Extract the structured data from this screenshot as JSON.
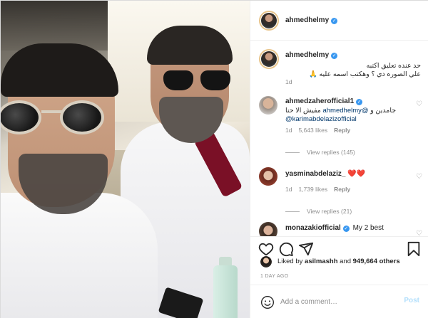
{
  "post": {
    "author": "ahmedhelmy",
    "caption_line1": "حد عنده تعليق اكتبه",
    "caption_line2": "علي الصوره دي ؟ وهكتب اسمه عليه 🙏",
    "caption_age": "1d"
  },
  "comments": [
    {
      "username": "ahmedzaherofficial1",
      "text_start": "جامدين و ",
      "mention1": "@ahmedhelmy",
      "text_mid": " مفيش الا حنا",
      "mention2": "@karimabdelazizofficial",
      "age": "1d",
      "likes": "5,643 likes",
      "reply": "Reply",
      "view_replies": "View replies (145)"
    },
    {
      "username": "yasminabdelaziz_",
      "text": "❤️❤️",
      "age": "1d",
      "likes": "1,739 likes",
      "reply": "Reply",
      "view_replies": "View replies (21)"
    },
    {
      "username": "monazakiofficial",
      "text": "My 2 best"
    }
  ],
  "likes": {
    "liked_by_user": "asilmashh",
    "and_label": " and ",
    "others": "949,664 others",
    "prefix": "Liked by "
  },
  "timestamp": "1 DAY AGO",
  "add_comment": {
    "placeholder": "Add a comment…",
    "post_label": "Post"
  },
  "icons": {
    "verified": "verified-badge-icon",
    "like": "heart-icon",
    "comment": "comment-icon",
    "share": "paper-plane-icon",
    "save": "bookmark-icon",
    "emoji": "smile-icon"
  },
  "colors": {
    "verified": "#3897f0",
    "link": "#00376b",
    "muted": "#8e8e8e",
    "post_button": "#b2dffc"
  }
}
